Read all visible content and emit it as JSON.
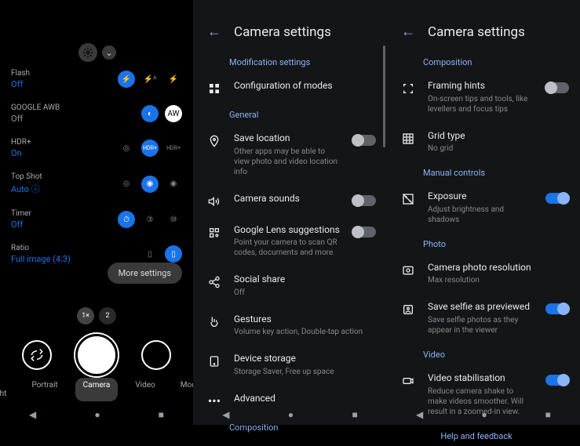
{
  "camera": {
    "settings": [
      {
        "name": "Flash",
        "value": "Off",
        "valueClass": "blue"
      },
      {
        "name": "GOOGLE AWB",
        "value": "Off",
        "valueClass": "off"
      },
      {
        "name": "HDR+",
        "value": "On",
        "valueClass": "blue"
      },
      {
        "name": "Top Shot",
        "value": "Auto ⓘ",
        "valueClass": "blue"
      },
      {
        "name": "Timer",
        "value": "Off",
        "valueClass": "blue"
      },
      {
        "name": "Ratio",
        "value": "Full image (4:3)",
        "valueClass": "blue"
      }
    ],
    "more_settings": "More settings",
    "zoom": [
      "1×",
      "2"
    ],
    "modes": [
      "ght Sight",
      "Portrait",
      "Camera",
      "Video",
      "Modes"
    ],
    "active_mode": 2
  },
  "settings_a": {
    "title": "Camera settings",
    "sections": {
      "mod": "Modification settings",
      "general": "General",
      "comp": "Composition"
    },
    "items": {
      "config_modes": "Configuration of modes",
      "save_location": {
        "title": "Save location",
        "sub": "Other apps may be able to view photo and video location info"
      },
      "camera_sounds": "Camera sounds",
      "lens": {
        "title": "Google Lens suggestions",
        "sub": "Point your camera to scan QR codes, documents and more"
      },
      "social": {
        "title": "Social share",
        "sub": "Off"
      },
      "gestures": {
        "title": "Gestures",
        "sub": "Volume key action, Double-tap action"
      },
      "storage": {
        "title": "Device storage",
        "sub": "Storage Saver, Free up space"
      },
      "advanced": "Advanced"
    }
  },
  "settings_b": {
    "title": "Camera settings",
    "sections": {
      "comp": "Composition",
      "manual": "Manual controls",
      "photo": "Photo",
      "video": "Video"
    },
    "items": {
      "framing": {
        "title": "Framing hints",
        "sub": "On-screen tips and tools, like levellers and focus tips"
      },
      "grid": {
        "title": "Grid type",
        "sub": "No grid"
      },
      "exposure": {
        "title": "Exposure",
        "sub": "Adjust brightness and shadows"
      },
      "resolution": {
        "title": "Camera photo resolution",
        "sub": "Max resolution"
      },
      "selfie": {
        "title": "Save selfie as previewed",
        "sub": "Save selfie photos as they appear in the viewer"
      },
      "stab": {
        "title": "Video stabilisation",
        "sub": "Reduce camera shake to make videos smoother. Will result in a zoomed-in view."
      }
    },
    "help": "Help and feedback"
  }
}
